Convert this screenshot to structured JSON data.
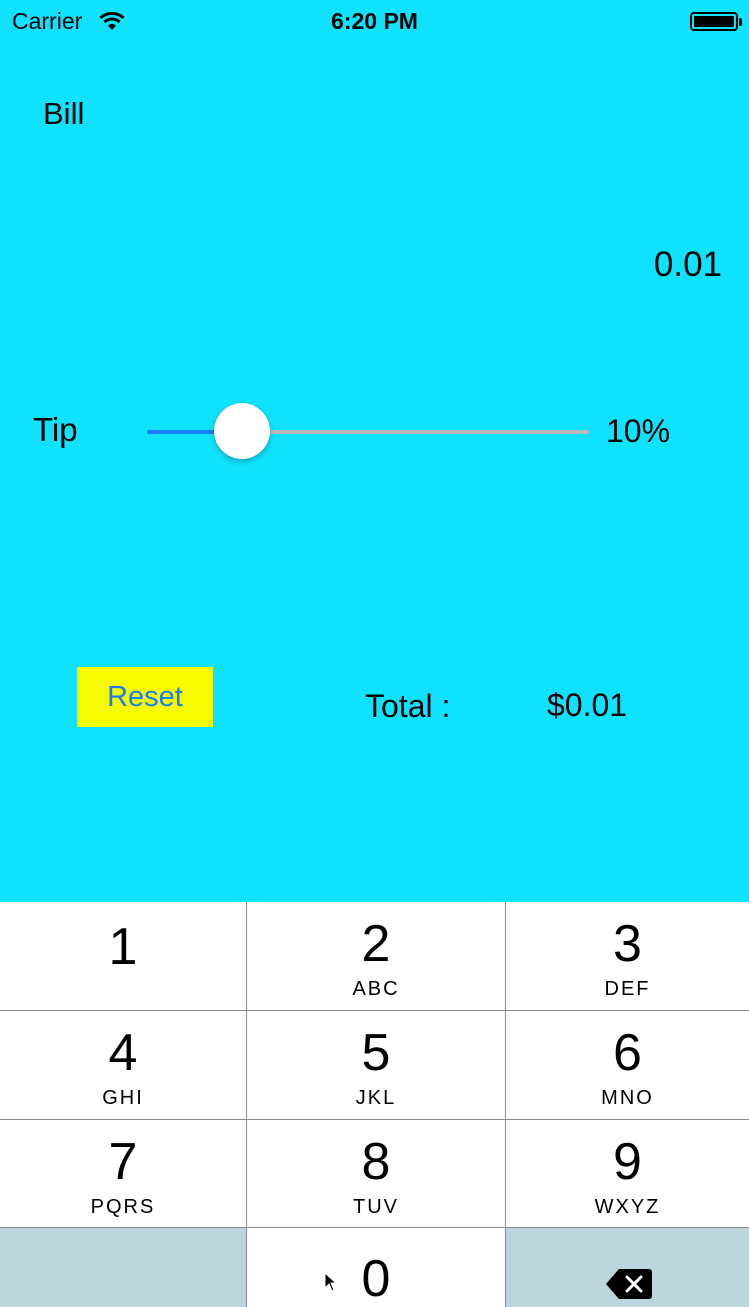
{
  "status_bar": {
    "carrier": "Carrier",
    "time": "6:20 PM",
    "icons": [
      "wifi-icon",
      "battery-icon"
    ]
  },
  "bill": {
    "label": "Bill",
    "value": "0.01"
  },
  "tip": {
    "label": "Tip",
    "percent_text": "10%",
    "slider_fraction": 0.15
  },
  "reset": {
    "label": "Reset"
  },
  "total": {
    "label": "Total :",
    "value": "$0.01"
  },
  "keypad": {
    "keys": [
      {
        "num": "1",
        "letters": ""
      },
      {
        "num": "2",
        "letters": "ABC"
      },
      {
        "num": "3",
        "letters": "DEF"
      },
      {
        "num": "4",
        "letters": "GHI"
      },
      {
        "num": "5",
        "letters": "JKL"
      },
      {
        "num": "6",
        "letters": "MNO"
      },
      {
        "num": "7",
        "letters": "PQRS"
      },
      {
        "num": "8",
        "letters": "TUV"
      },
      {
        "num": "9",
        "letters": "WXYZ"
      },
      {
        "num": "",
        "letters": ""
      },
      {
        "num": "0",
        "letters": ""
      },
      {
        "num": "",
        "letters": ""
      }
    ],
    "delete_icon": "backspace-icon"
  },
  "colors": {
    "background": "#10e2fd",
    "reset_bg": "#f7fb00",
    "accent": "#1a7df7",
    "key_gray": "#bcd4dc"
  }
}
